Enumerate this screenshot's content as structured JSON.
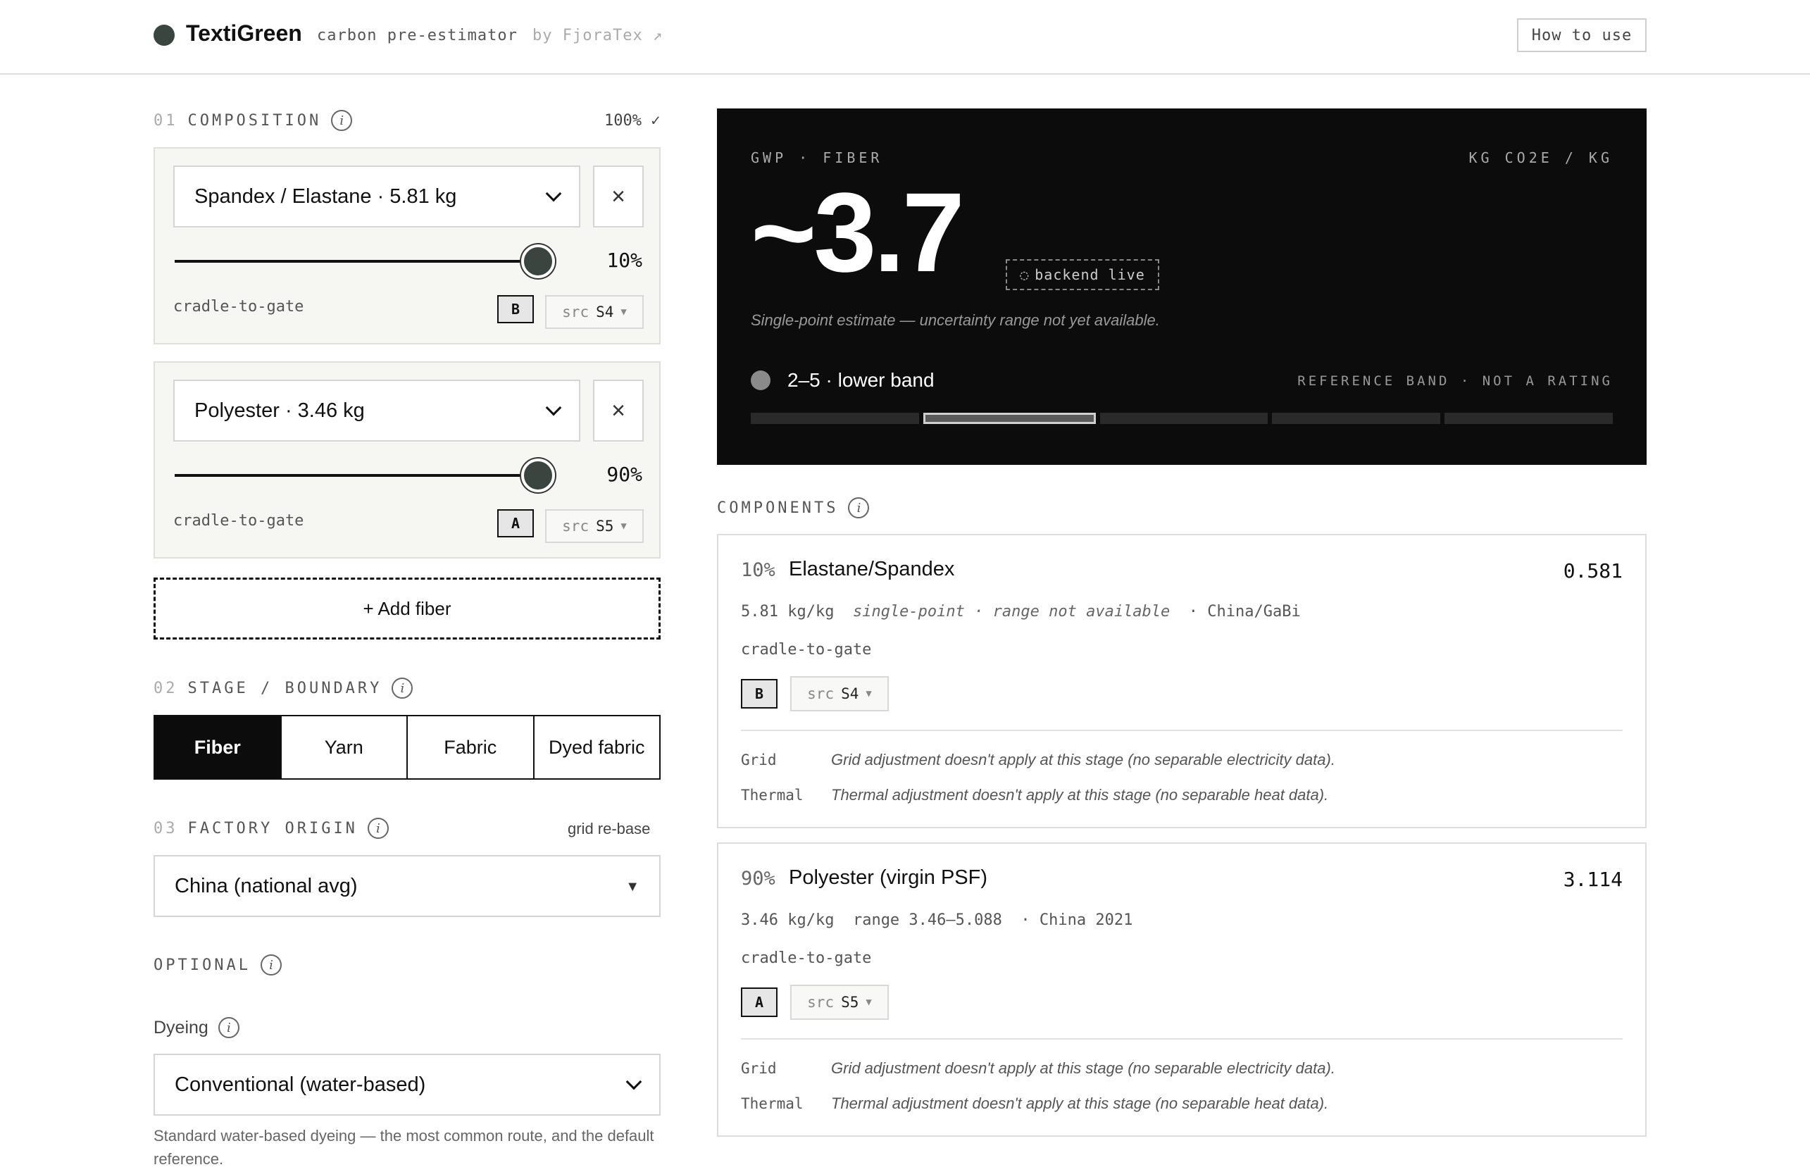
{
  "header": {
    "brand": "TextiGreen",
    "tagline": "carbon pre-estimator",
    "byline": "by FjoraTex ↗",
    "howto_label": "How to use"
  },
  "composition": {
    "num": "01",
    "label": "COMPOSITION",
    "total": "100% ✓",
    "fibers": [
      {
        "select_value": "Spandex / Elastane · 5.81 kg",
        "percent_text": "10%",
        "percent": 10,
        "boundary": "cradle-to-gate",
        "grade": "B",
        "src_prefix": "src",
        "src": "S4"
      },
      {
        "select_value": "Polyester · 3.46 kg",
        "percent_text": "90%",
        "percent": 90,
        "boundary": "cradle-to-gate",
        "grade": "A",
        "src_prefix": "src",
        "src": "S5"
      }
    ],
    "add_label": "+ Add fiber"
  },
  "stage": {
    "num": "02",
    "label": "STAGE / BOUNDARY",
    "tabs": [
      "Fiber",
      "Yarn",
      "Fabric",
      "Dyed fabric"
    ],
    "active": "Fiber"
  },
  "factory": {
    "num": "03",
    "label": "FACTORY ORIGIN",
    "note": "grid re-base",
    "value": "China (national avg)"
  },
  "optional": {
    "label": "OPTIONAL",
    "dyeing_label": "Dyeing",
    "dyeing_value": "Conventional (water-based)",
    "dyeing_desc": "Standard water-based dyeing — the most common route, and the default reference."
  },
  "result": {
    "label": "GWP · FIBER",
    "unit": "KG CO2E / KG",
    "value": "~3.7",
    "backend": "backend live",
    "note": "Single-point estimate — uncertainty range not yet available.",
    "band_label": "2–5 · lower band",
    "band_note": "REFERENCE BAND · NOT A RATING",
    "band_segments": 5,
    "band_active_index": 1
  },
  "components": {
    "label": "COMPONENTS",
    "items": [
      {
        "pct": "10%",
        "name": "Elastane/Spandex",
        "value": "0.581",
        "factor": "5.81 kg/kg",
        "range": "single-point · range not available",
        "region": "· China/GaBi",
        "boundary": "cradle-to-gate",
        "grade": "B",
        "src_prefix": "src",
        "src": "S4",
        "grid_key": "Grid",
        "grid_text": "Grid adjustment doesn't apply at this stage (no separable electricity data).",
        "thermal_key": "Thermal",
        "thermal_text": "Thermal adjustment doesn't apply at this stage (no separable heat data)."
      },
      {
        "pct": "90%",
        "name": "Polyester (virgin PSF)",
        "value": "3.114",
        "factor": "3.46 kg/kg",
        "range": "range 3.46–5.088",
        "region": "· China 2021",
        "boundary": "cradle-to-gate",
        "grade": "A",
        "src_prefix": "src",
        "src": "S5",
        "grid_key": "Grid",
        "grid_text": "Grid adjustment doesn't apply at this stage (no separable electricity data).",
        "thermal_key": "Thermal",
        "thermal_text": "Thermal adjustment doesn't apply at this stage (no separable heat data)."
      }
    ]
  }
}
